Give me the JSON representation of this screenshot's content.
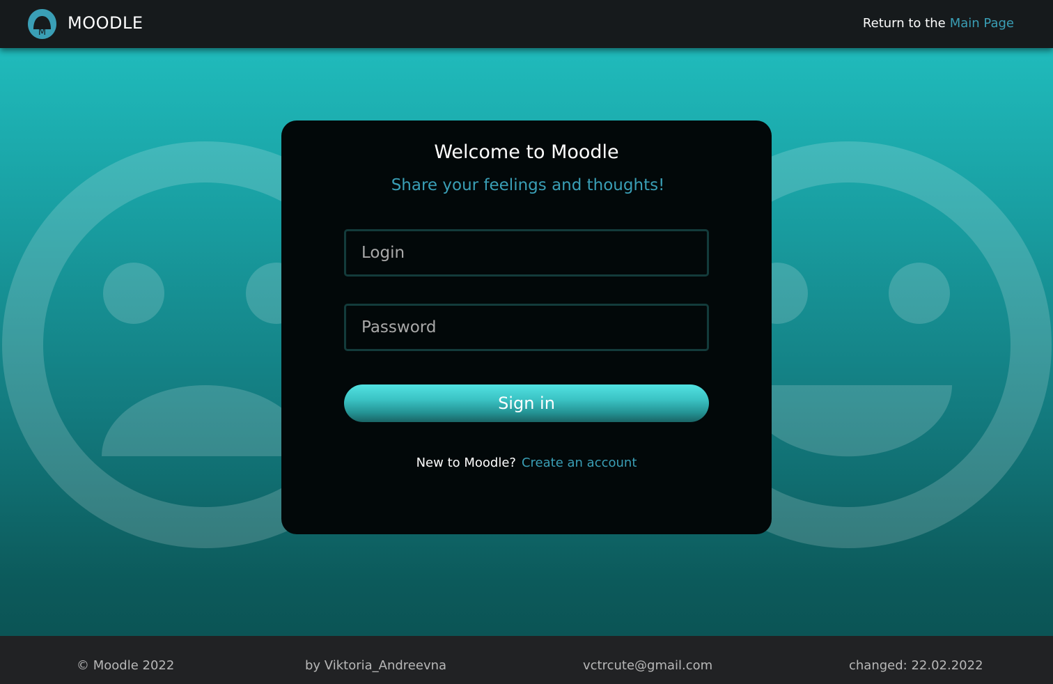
{
  "header": {
    "brand": "MOODLE",
    "logo_letter": "M",
    "return_text": "Return to the",
    "return_link": "Main Page"
  },
  "card": {
    "title": "Welcome to Moodle",
    "subtitle": "Share your feelings and thoughts!",
    "login_placeholder": "Login",
    "password_placeholder": "Password",
    "signin_label": "Sign in",
    "new_user_text": "New to Moodle?",
    "create_account_link": "Create an account"
  },
  "footer": {
    "copyright": "© Moodle 2022",
    "author": "by Viktoria_Andreevna",
    "email": "vctrcute@gmail.com",
    "changed": "changed: 22.02.2022"
  },
  "colors": {
    "accent": "#3a9fb6",
    "header_bg": "#161a1c",
    "card_bg": "#020809",
    "footer_bg": "#212224"
  },
  "icons": [
    "moodle-logo-icon",
    "sad-face-icon",
    "happy-face-icon"
  ]
}
